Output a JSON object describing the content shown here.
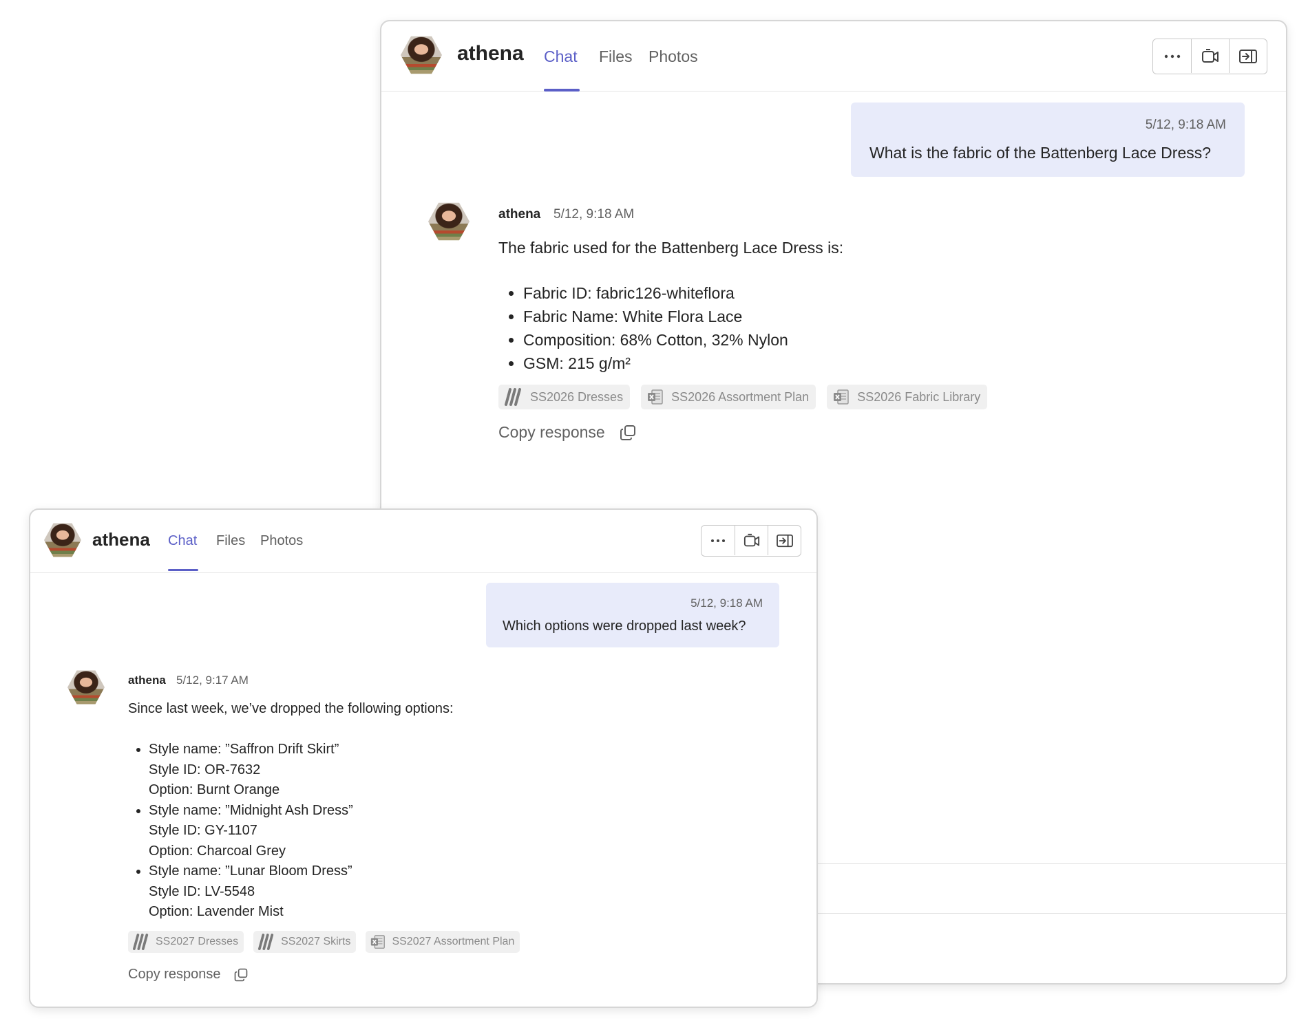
{
  "back_window": {
    "header": {
      "name": "athena",
      "tabs": [
        {
          "label": "Chat",
          "active": true
        },
        {
          "label": "Files",
          "active": false
        },
        {
          "label": "Photos",
          "active": false
        }
      ],
      "buttons": [
        "more-options-icon",
        "video-call-icon",
        "open-side-panel-icon"
      ]
    },
    "user_message": {
      "timestamp": "5/12, 9:18 AM",
      "text": "What is the fabric of the Battenberg Lace Dress?"
    },
    "bot_message": {
      "sender": "athena",
      "timestamp": "5/12, 9:18 AM",
      "intro": "The fabric used for the Battenberg Lace Dress is:",
      "items": [
        "Fabric ID: fabric126-whiteflora",
        "Fabric Name: White Flora Lace",
        "Composition: 68% Cotton, 32% Nylon",
        "GSM: 215 g/m²"
      ],
      "sources": [
        {
          "label": "SS2026 Dresses",
          "icon": "stripes-logo-icon"
        },
        {
          "label": "SS2026 Assortment Plan",
          "icon": "excel-file-icon"
        },
        {
          "label": "SS2026 Fabric Library",
          "icon": "excel-file-icon"
        }
      ],
      "copy_label": "Copy response"
    }
  },
  "front_window": {
    "header": {
      "name": "athena",
      "tabs": [
        {
          "label": "Chat",
          "active": true
        },
        {
          "label": "Files",
          "active": false
        },
        {
          "label": "Photos",
          "active": false
        }
      ],
      "buttons": [
        "more-options-icon",
        "video-call-icon",
        "open-side-panel-icon"
      ]
    },
    "user_message": {
      "timestamp": "5/12, 9:18 AM",
      "text": "Which options were dropped last week?"
    },
    "bot_message": {
      "sender": "athena",
      "timestamp": "5/12, 9:17 AM",
      "intro": "Since last week, we’ve dropped the following options:",
      "items": [
        {
          "style_name": "Style name: ”Saffron Drift Skirt”",
          "style_id": "Style ID: OR-7632",
          "option": "Option: Burnt Orange"
        },
        {
          "style_name": "Style name: ”Midnight Ash Dress”",
          "style_id": "Style ID: GY-1107",
          "option": "Option: Charcoal Grey"
        },
        {
          "style_name": "Style name: ”Lunar Bloom Dress”",
          "style_id": "Style ID: LV-5548",
          "option": "Option: Lavender Mist"
        }
      ],
      "sources": [
        {
          "label": "SS2027 Dresses",
          "icon": "stripes-logo-icon"
        },
        {
          "label": "SS2027 Skirts",
          "icon": "stripes-logo-icon"
        },
        {
          "label": "SS2027 Assortment Plan",
          "icon": "excel-file-icon"
        }
      ],
      "copy_label": "Copy response"
    }
  },
  "colors": {
    "accent": "#5b5fc7",
    "user_bubble": "#e8ebfa",
    "chip_bg": "#f0f0f0",
    "muted_text": "#616161"
  }
}
